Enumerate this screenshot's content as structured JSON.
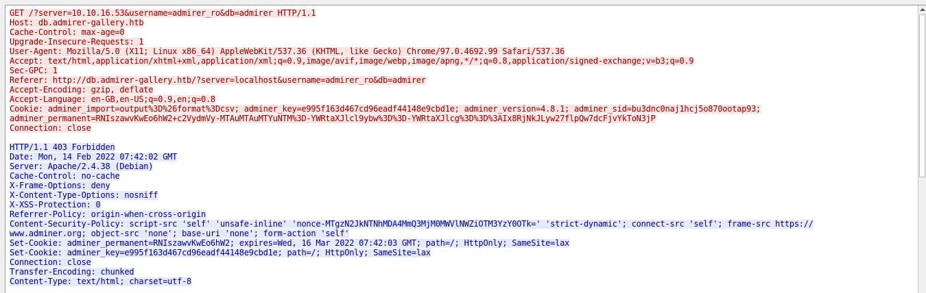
{
  "request_lines": [
    "GET /?server=10.10.16.53&username=admirer_ro&db=admirer HTTP/1.1",
    "Host: db.admirer-gallery.htb",
    "Cache-Control: max-age=0",
    "Upgrade-Insecure-Requests: 1",
    "User-Agent: Mozilla/5.0 (X11; Linux x86_64) AppleWebKit/537.36 (KHTML, like Gecko) Chrome/97.0.4692.99 Safari/537.36",
    "Accept: text/html,application/xhtml+xml,application/xml;q=0.9,image/avif,image/webp,image/apng,*/*;q=0.8,application/signed-exchange;v=b3;q=0.9",
    "Sec-GPC: 1",
    "Referer: http://db.admirer-gallery.htb/?server=localhost&username=admirer_ro&db=admirer",
    "Accept-Encoding: gzip, deflate",
    "Accept-Language: en-GB,en-US;q=0.9,en;q=0.8",
    "Cookie: adminer_import=output%3D%26format%3Dcsv; adminer_key=e995f163d467cd96eadf44148e9cbd1e; adminer_version=4.8.1; adminer_sid=bu3dnc0naj1hcj5o870ootap93;",
    "adminer_permanent=RNIszawvKwEo6hW2+c2VydmVy-MTAuMTAuMTYuNTM%3D-YWRtaXJlcl9ybw%3D%3D-YWRtaXJlcg%3D%3D%3AIx8RjNkJLyw27flpQw7dcFjvYkToN3jP",
    "Connection: close"
  ],
  "response_lines": [
    "HTTP/1.1 403 Forbidden",
    "Date: Mon, 14 Feb 2022 07:42:02 GMT",
    "Server: Apache/2.4.38 (Debian)",
    "Cache-Control: no-cache",
    "X-Frame-Options: deny",
    "X-Content-Type-Options: nosniff",
    "X-XSS-Protection: 0",
    "Referrer-Policy: origin-when-cross-origin",
    "Content-Security-Policy: script-src 'self' 'unsafe-inline' 'nonce-MTgzN2JkNTNhMDA4MmQ3MjM0MWVlNWZiOTM3YzY0OTk=' 'strict-dynamic'; connect-src 'self'; frame-src https://",
    "www.adminer.org; object-src 'none'; base-uri 'none'; form-action 'self'",
    "Set-Cookie: adminer_permanent=RNIszawvKwEo6hW2; expires=Wed, 16 Mar 2022 07:42:03 GMT; path=/; HttpOnly; SameSite=lax",
    "Set-Cookie: adminer_key=e995f163d467cd96eadf44148e9cbd1e; path=/; HttpOnly; SameSite=lax",
    "Connection: close",
    "Transfer-Encoding: chunked",
    "Content-Type: text/html; charset=utf-8"
  ],
  "colors": {
    "request_text": "#8b0000",
    "request_highlight": "#f9e4e4",
    "response_text": "#000080",
    "response_highlight": "#e6e9f7"
  },
  "scroll": {
    "position_fraction": 0.0,
    "visible_fraction": 0.58
  }
}
